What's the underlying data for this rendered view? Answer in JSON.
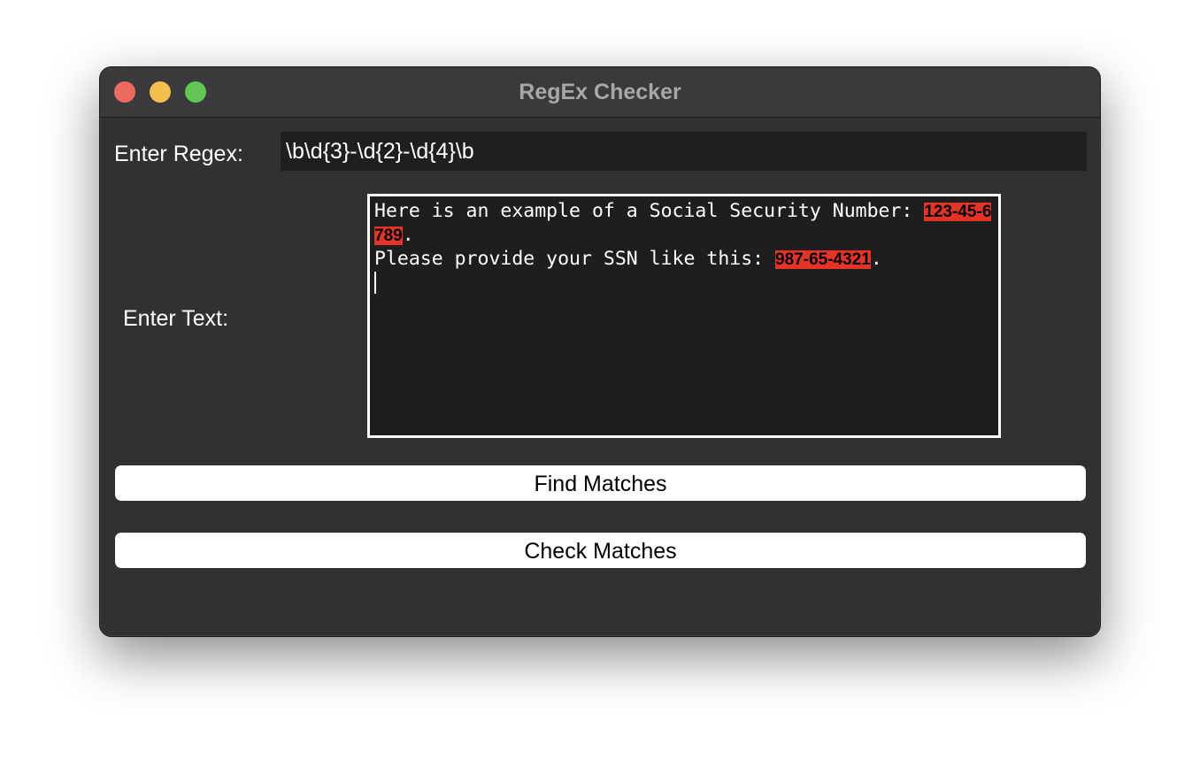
{
  "window": {
    "title": "RegEx Checker"
  },
  "regex": {
    "label": "Enter Regex:",
    "value": "\\b\\d{3}-\\d{2}-\\d{4}\\b"
  },
  "text": {
    "label": "Enter Text:",
    "line1_prefix": "Here is an example of a Social Security Number: ",
    "line1_match": "123-45-6789",
    "line1_suffix": ".",
    "line2_prefix": "Please provide your SSN like this: ",
    "line2_match": "987-65-4321",
    "line2_suffix": "."
  },
  "buttons": {
    "find_label": "Find Matches",
    "check_label": "Check Matches"
  },
  "colors": {
    "match_highlight": "#e53326",
    "window_bg": "#313132",
    "titlebar_bg": "#3a393c"
  }
}
